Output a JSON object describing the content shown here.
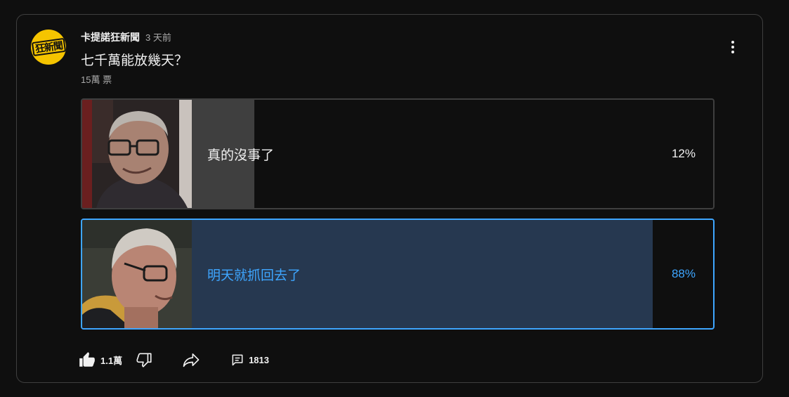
{
  "post": {
    "author": "卡提諾狂新聞",
    "time": "3 天前",
    "avatar_text": "狂新聞",
    "question": "七千萬能放幾天？",
    "votes": "15萬 票",
    "menu_icon": "more-vert-icon"
  },
  "poll": {
    "options": [
      {
        "label": "真的沒事了",
        "percent": "12%",
        "fraction": 0.12,
        "selected": false
      },
      {
        "label": "明天就抓回去了",
        "percent": "88%",
        "fraction": 0.88,
        "selected": true
      }
    ]
  },
  "actions": {
    "like_count": "1.1萬",
    "comment_count": "1813",
    "like_icon": "thumb-up-icon",
    "dislike_icon": "thumb-down-icon",
    "share_icon": "share-icon",
    "comment_icon": "comment-icon"
  },
  "colors": {
    "background": "#0f0f0f",
    "border": "#3f3f3f",
    "accent": "#3ea6ff",
    "selected_bar": "#263850",
    "bar": "#3f3f3f",
    "avatar": "#f5c400"
  }
}
